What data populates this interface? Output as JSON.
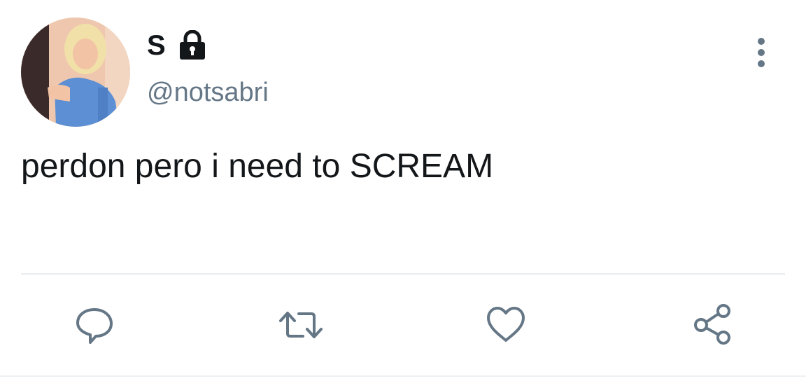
{
  "tweet": {
    "display_name": "S",
    "handle": "@notsabri",
    "text": "perdon pero i need to SCREAM",
    "protected_icon": "lock-icon",
    "more_icon": "more-vertical-icon"
  },
  "actions": {
    "reply_icon": "comment-bubble-icon",
    "retweet_icon": "retweet-icon",
    "like_icon": "heart-icon",
    "share_icon": "share-icon"
  },
  "colors": {
    "text_primary": "#14171a",
    "text_secondary": "#657786",
    "icon": "#657786",
    "divider": "#e6ecf0"
  }
}
